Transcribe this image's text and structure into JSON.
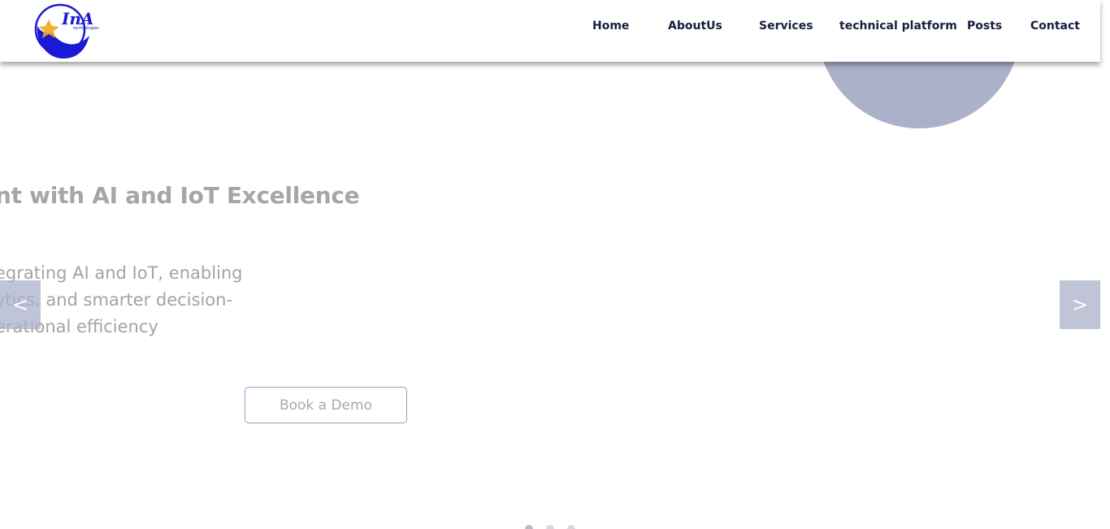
{
  "header": {
    "logo_text": "InA",
    "logo_subtext": "technologies",
    "nav": [
      {
        "label": "Home"
      },
      {
        "label": "AboutUs"
      },
      {
        "label": "Services"
      },
      {
        "label": "technical platform"
      },
      {
        "label": "Posts"
      },
      {
        "label": "Contact"
      }
    ]
  },
  "hero": {
    "title": "nt with AI and IoT Excellence",
    "description_lines": [
      "egrating AI and IoT, enabling",
      "ytics, and smarter decision-",
      "erational efficiency"
    ],
    "cta_label": "Book a Demo"
  },
  "carousel": {
    "prev_label": "<",
    "next_label": ">",
    "slide_count": 3,
    "active_slide": 1
  },
  "colors": {
    "nav_text": "#14213d",
    "accent_circle": "#aab1c9",
    "logo_blue": "#1a1ad6",
    "logo_orange": "#f2a81d"
  },
  "icons": {
    "logo": "ina-technologies-logo",
    "prev": "chevron-left",
    "next": "chevron-right"
  }
}
